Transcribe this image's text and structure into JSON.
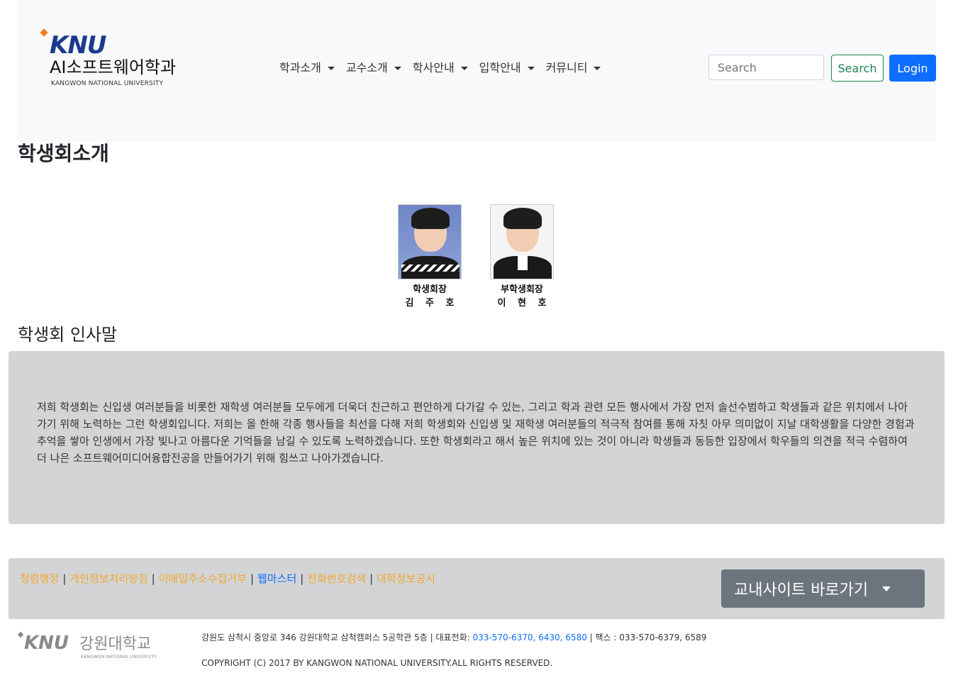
{
  "header": {
    "logo_knu": "KNU",
    "logo_dept": "AI소프트웨어학과",
    "logo_sub": "KANGWON NATIONAL UNIVERSITY",
    "nav": [
      {
        "label": "학과소개"
      },
      {
        "label": "교수소개"
      },
      {
        "label": "학사안내"
      },
      {
        "label": "입학안내"
      },
      {
        "label": "커뮤니티"
      }
    ],
    "search_placeholder": "Search",
    "search_label": "Search",
    "login_label": "Login"
  },
  "main": {
    "title": "학생회소개",
    "members": [
      {
        "role": "학생회장",
        "name": "김 주 호"
      },
      {
        "role": "부학생회장",
        "name": "이 현 호"
      }
    ],
    "greeting_title": "학생회 인사말",
    "greeting_text": "저희 학생회는 신입생 여러분들을 비롯한 재학생 여러분들 모두에게 더욱더 친근하고 편안하게 다가갈 수 있는, 그리고 학과 관련 모든 행사에서 가장 먼저 솔선수범하고 학생들과 같은 위치에서 나아가기 위해 노력하는 그런 학생회입니다. 저희는 올 한해 각종 행사들을 최선을 다해 저희 학생회와 신입생 및 재학생 여러분들의 적극적 참여를 통해 자칫 아무 의미없이 지날 대학생활을 다양한 경험과 추억을 쌓아 인생에서 가장 빛나고 아름다운 기억들을 남길 수 있도록 노력하겠습니다. 또한 학생회라고 해서 높은 위치에 있는 것이 아니라 학생들과 동등한 입장에서 학우들의 의견을 적극 수렴하여 더 나은 소프트웨어미디어융합전공을 만들어가기 위해 힘쓰고 나아가겠습니다."
  },
  "footer": {
    "links": [
      {
        "label": "청렴행정"
      },
      {
        "label": "개인정보처리방침"
      },
      {
        "label": "이메일주소수집거부"
      },
      {
        "label": "웹마스터"
      },
      {
        "label": "전화번호검색"
      },
      {
        "label": "대학정보공시"
      }
    ],
    "link_separator": "|",
    "site_button": "교내사이트 바로가기",
    "logo_knu": "KNU",
    "logo_name": "강원대학교",
    "logo_sub": "KANGWON NATIONAL UNIVERSITY",
    "address_prefix": "강원도 삼척시 중앙로 346 강원대학교 삼척캠퍼스 5공학관 5층 | 대표전화: ",
    "phone_numbers": "033-570-6370, 6430, 6580",
    "fax": " | 팩스 : 033-570-6379, 6589",
    "copyright": "COPYRIGHT (C) 2017 BY KANGWON NATIONAL UNIVERSITY.ALL RIGHTS RESERVED."
  },
  "colors": {
    "accent": "#0d6efd",
    "search_green": "#198754",
    "footer_link": "#f0a830",
    "panel_gray": "#d3d4d6",
    "header_bg": "#f8f9fa",
    "site_button_bg": "#6c757d"
  }
}
